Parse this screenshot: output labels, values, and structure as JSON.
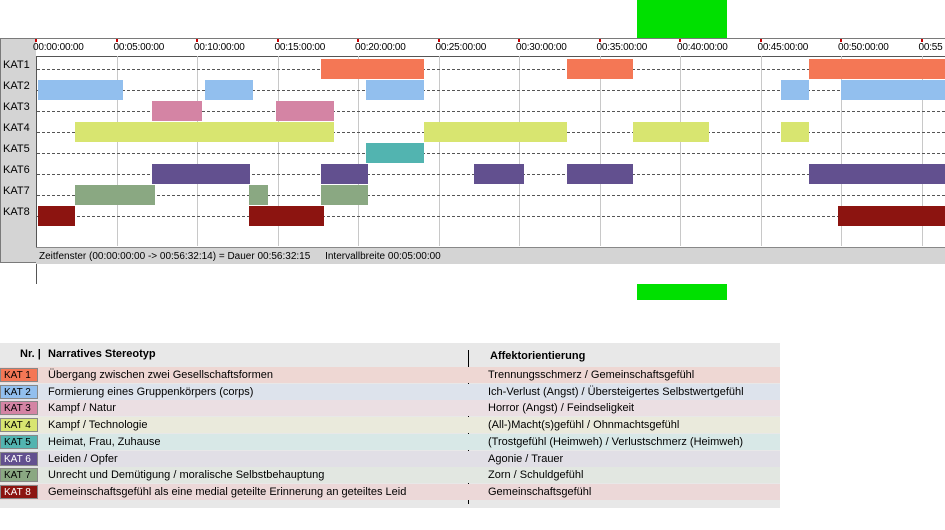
{
  "ruler": {
    "ticks": [
      "00:00:00:00",
      "00:05:00:00",
      "00:10:00:00",
      "00:15:00:00",
      "00:20:00:00",
      "00:25:00:00",
      "00:30:00:00",
      "00:35:00:00",
      "00:40:00:00",
      "00:45:00:00",
      "00:50:00:00",
      "00:55"
    ]
  },
  "rows": [
    "KAT1",
    "KAT2",
    "KAT3",
    "KAT4",
    "KAT5",
    "KAT6",
    "KAT7",
    "KAT8"
  ],
  "colors": {
    "KAT1": "#f47755",
    "KAT2": "#92bfee",
    "KAT3": "#d484a4",
    "KAT4": "#d8e570",
    "KAT5": "#52b4b0",
    "KAT6": "#62508f",
    "KAT7": "#8aa882",
    "KAT8": "#8c1410"
  },
  "segments_minutes": {
    "KAT1": [
      [
        17.7,
        24.1
      ],
      [
        33.0,
        37.1
      ],
      [
        48.0,
        56.6
      ]
    ],
    "KAT2": [
      [
        -0.2,
        5.4
      ],
      [
        10.5,
        13.5
      ],
      [
        20.5,
        24.1
      ],
      [
        46.3,
        48.0
      ],
      [
        50.0,
        56.6
      ]
    ],
    "KAT3": [
      [
        7.2,
        10.3
      ],
      [
        14.9,
        18.5
      ]
    ],
    "KAT4": [
      [
        2.4,
        18.5
      ],
      [
        24.1,
        33.0
      ],
      [
        37.1,
        41.8
      ],
      [
        46.3,
        48.0
      ]
    ],
    "KAT5": [
      [
        20.5,
        24.1
      ]
    ],
    "KAT6": [
      [
        7.2,
        13.3
      ],
      [
        17.7,
        20.6
      ],
      [
        27.2,
        30.3
      ],
      [
        33.0,
        37.1
      ],
      [
        48.0,
        56.6
      ]
    ],
    "KAT7": [
      [
        2.4,
        7.4
      ],
      [
        13.2,
        14.4
      ],
      [
        17.7,
        20.6
      ]
    ],
    "KAT8": [
      [
        -0.2,
        2.4
      ],
      [
        13.2,
        17.9
      ],
      [
        49.8,
        56.6
      ]
    ]
  },
  "status": {
    "zeitfenster": "Zeitfenster (00:00:00:00 -> 00:56:32:14) = Dauer 00:56:32:15",
    "intervall": "Intervallbreite 00:05:00:00"
  },
  "legend": {
    "col_nr": "Nr. |",
    "col_stereotyp": "Narratives Stereotyp",
    "col_affekt": "Affektorientierung",
    "items": [
      {
        "nr": "KAT 1",
        "stereotyp": "Übergang zwischen zwei Gesellschaftsformen",
        "affekt": "Trennungsschmerz / Gemeinschaftsgefühl",
        "bg": "#eed7d3"
      },
      {
        "nr": "KAT 2",
        "stereotyp": "Formierung eines Gruppenkörpers (corps)",
        "affekt": "Ich-Verlust (Angst) / Übersteigertes Selbstwertgefühl",
        "bg": "#dde3ec"
      },
      {
        "nr": "KAT 3",
        "stereotyp": "Kampf / Natur",
        "affekt": "Horror (Angst) / Feindseligkeit",
        "bg": "#ebdfe3"
      },
      {
        "nr": "KAT 4",
        "stereotyp": "Kampf / Technologie",
        "affekt": "(All-)Macht(s)gefühl / Ohnmachtsgefühl",
        "bg": "#eaeadc"
      },
      {
        "nr": "KAT 5",
        "stereotyp": "Heimat, Frau, Zuhause",
        "affekt": "(Trostgefühl (Heimweh) / Verlustschmerz (Heimweh)",
        "bg": "#d8e8e7"
      },
      {
        "nr": "KAT 6",
        "stereotyp": "Leiden / Opfer",
        "affekt": "Agonie / Trauer",
        "bg": "#e1dfe6"
      },
      {
        "nr": "KAT 7",
        "stereotyp": "Unrecht und Demütigung / moralische Selbstbehauptung",
        "affekt": "Zorn / Schuldgefühl",
        "bg": "#e2e7e1"
      },
      {
        "nr": "KAT 8",
        "stereotyp": "Gemeinschaftsgefühl als eine medial geteilte Erinnerung an geteiltes Leid",
        "affekt": "Gemeinschaftsgefühl",
        "bg": "#ecd8d8"
      }
    ]
  }
}
